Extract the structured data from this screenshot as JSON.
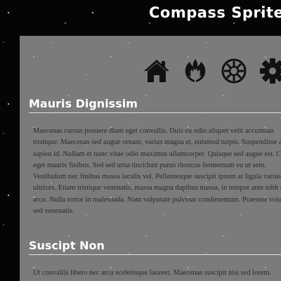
{
  "site": {
    "title": "Compass Sprites"
  },
  "nav_icons": [
    {
      "icon": "home-icon",
      "color": "#111111"
    },
    {
      "icon": "rebel-alliance-icon",
      "color": "#111111"
    },
    {
      "icon": "galactic-empire-icon",
      "color": "#111111"
    },
    {
      "icon": "gear-icon",
      "color": "#111111"
    }
  ],
  "sections": [
    {
      "heading": "Mauris Dignissim",
      "body": "Maecenas cursus posuere diam eget convallis. Duis eu odio aliquet velit accumsan tristique. Maecenas sed augue ornare, varius magna et, euismod turpis. Suspendisse a sapien id. Nullam et nunc vitae odio maximus ullamcorper. Quisque sed augue est. Cras eget mauris finibus. Sed sed urna tincidunt purus rhoncus fermentum eu ut sem. Vestibulum nec finibus massa iaculis vel. Pellentesque suscipit ipsum at ligula varius ultrices. Etiam tristique venenatis, massa magna dapibus massa, in tempor ante nibh sed arcu. Nulla tortor in malesuada. Nam vulputate pulvinar condimentum. Praesent volutpat sed venenatis."
    },
    {
      "heading": "Suscipt Non",
      "body": "Ut convallis libero nec arcu scelerisque laoreet. Maecenas suscipit nisi sed lorem."
    }
  ],
  "colors": {
    "page_background": "#050505",
    "panel_background": "#7b7b7b",
    "heading_text": "#ffffff",
    "body_text": "#2a2a2a"
  }
}
